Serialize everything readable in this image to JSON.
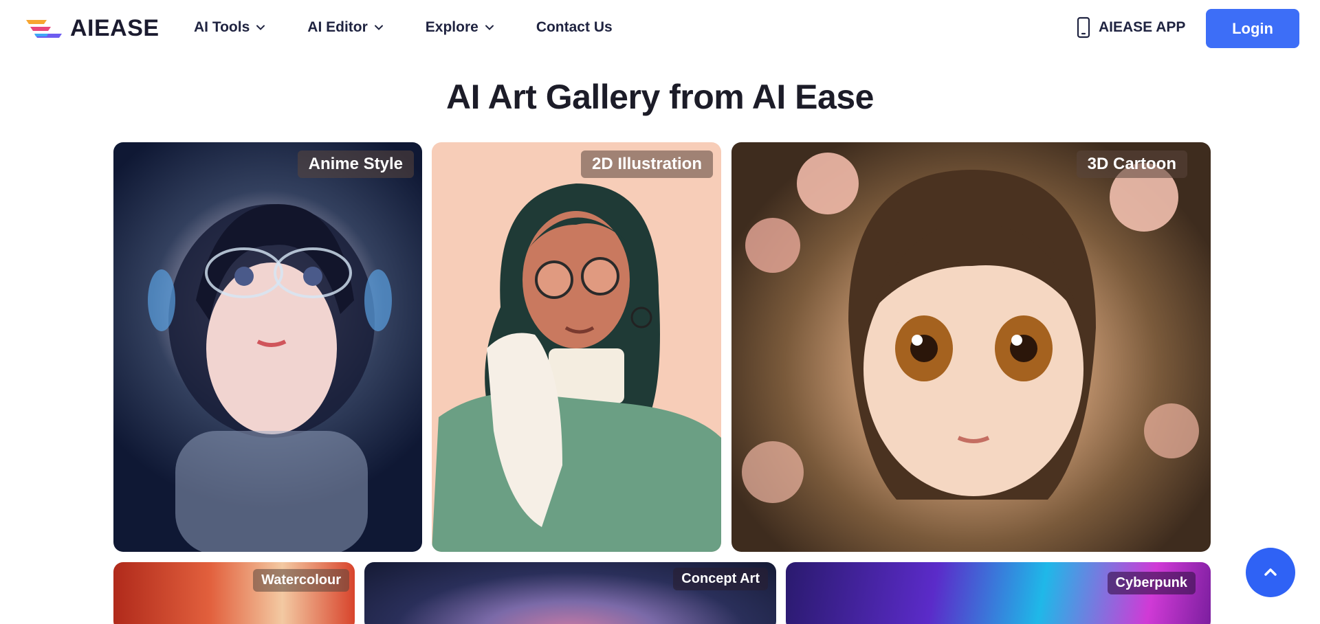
{
  "header": {
    "brand": "AIEASE",
    "logo_icon": "aiease-logo-icon",
    "nav": [
      {
        "label": "AI Tools",
        "icon": "chevron-down-icon"
      },
      {
        "label": "AI Editor",
        "icon": "chevron-down-icon"
      },
      {
        "label": "Explore",
        "icon": "chevron-down-icon"
      },
      {
        "label": "Contact Us"
      }
    ],
    "app_link": {
      "label": "AIEASE APP",
      "icon": "smartphone-icon"
    },
    "login_label": "Login"
  },
  "main": {
    "title": "AI Art Gallery from AI Ease",
    "gallery": [
      {
        "label": "Anime Style"
      },
      {
        "label": "2D Illustration"
      },
      {
        "label": "3D Cartoon"
      },
      {
        "label": "Watercolour"
      },
      {
        "label": "Concept Art"
      },
      {
        "label": "Cyberpunk"
      }
    ]
  },
  "scroll_top": {
    "icon": "chevron-up-icon"
  },
  "colors": {
    "accent": "#3d6ef7",
    "scroll_button": "#2f62f5",
    "text": "#1c1c28"
  }
}
